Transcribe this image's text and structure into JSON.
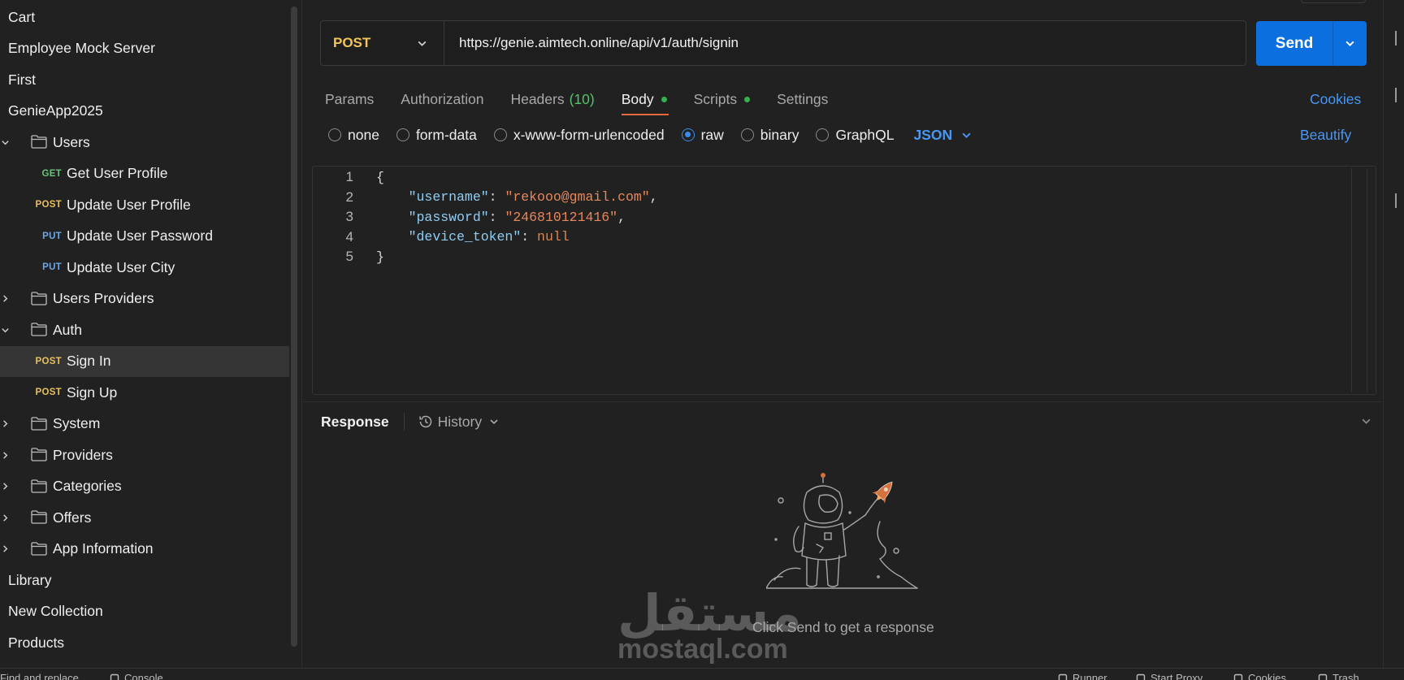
{
  "sidebar": {
    "items": [
      {
        "label": "Cart",
        "kind": "collection"
      },
      {
        "label": "Employee Mock Server",
        "kind": "collection"
      },
      {
        "label": "First",
        "kind": "collection"
      },
      {
        "label": "GenieApp2025",
        "kind": "collection"
      },
      {
        "label": "Users",
        "kind": "folder",
        "expanded": true
      },
      {
        "label": "Get User Profile",
        "kind": "request",
        "method": "GET"
      },
      {
        "label": "Update User Profile",
        "kind": "request",
        "method": "POST"
      },
      {
        "label": "Update User Password",
        "kind": "request",
        "method": "PUT"
      },
      {
        "label": "Update User City",
        "kind": "request",
        "method": "PUT"
      },
      {
        "label": "Users Providers",
        "kind": "folder",
        "expanded": false
      },
      {
        "label": "Auth",
        "kind": "folder",
        "expanded": true
      },
      {
        "label": "Sign In",
        "kind": "request",
        "method": "POST",
        "selected": true
      },
      {
        "label": "Sign Up",
        "kind": "request",
        "method": "POST"
      },
      {
        "label": "System",
        "kind": "folder",
        "expanded": false
      },
      {
        "label": "Providers",
        "kind": "folder",
        "expanded": false
      },
      {
        "label": "Categories",
        "kind": "folder",
        "expanded": false
      },
      {
        "label": "Offers",
        "kind": "folder",
        "expanded": false
      },
      {
        "label": "App Information",
        "kind": "folder",
        "expanded": false
      },
      {
        "label": "Library",
        "kind": "collection"
      },
      {
        "label": "New Collection",
        "kind": "collection"
      },
      {
        "label": "Products",
        "kind": "collection"
      }
    ]
  },
  "request": {
    "method": "POST",
    "url": "https://genie.aimtech.online/api/v1/auth/signin",
    "send_label": "Send"
  },
  "tabs": [
    {
      "label": "Params",
      "active": false
    },
    {
      "label": "Authorization",
      "active": false
    },
    {
      "label": "Headers",
      "count": "(10)",
      "active": false
    },
    {
      "label": "Body",
      "dot": true,
      "active": true
    },
    {
      "label": "Scripts",
      "dot": true,
      "active": false
    },
    {
      "label": "Settings",
      "active": false
    }
  ],
  "cookies_label": "Cookies",
  "body_types": [
    {
      "label": "none",
      "checked": false
    },
    {
      "label": "form-data",
      "checked": false
    },
    {
      "label": "x-www-form-urlencoded",
      "checked": false
    },
    {
      "label": "raw",
      "checked": true
    },
    {
      "label": "binary",
      "checked": false
    },
    {
      "label": "GraphQL",
      "checked": false
    }
  ],
  "body_language": "JSON",
  "beautify_label": "Beautify",
  "editor": {
    "lines": [
      {
        "n": "1",
        "open": "{"
      },
      {
        "n": "2",
        "key": "\"username\"",
        "value": "\"rekooo@gmail.com\"",
        "vtype": "s",
        "comma": ","
      },
      {
        "n": "3",
        "key": "\"password\"",
        "value": "\"246810121416\"",
        "vtype": "s",
        "comma": ","
      },
      {
        "n": "4",
        "key": "\"device_token\"",
        "value": "null",
        "vtype": "n",
        "comma": ""
      },
      {
        "n": "5",
        "close": "}"
      }
    ]
  },
  "response": {
    "title": "Response",
    "history_label": "History",
    "empty_message": "Click Send to get a response"
  },
  "watermark": {
    "arabic": "مستقل",
    "latin": "mostaql.com"
  },
  "statusbar": {
    "items": [
      "Find and replace",
      "Console",
      "Runner",
      "Start Proxy",
      "Cookies",
      "Trash"
    ]
  },
  "colors": {
    "accent_blue": "#0c6fe0",
    "link_blue": "#4a97f2",
    "tab_underline": "#e8693a",
    "method_get": "#6bc27c",
    "method_post": "#e8c05e",
    "method_put": "#6aa7e8",
    "dot_green": "#35b24f"
  }
}
